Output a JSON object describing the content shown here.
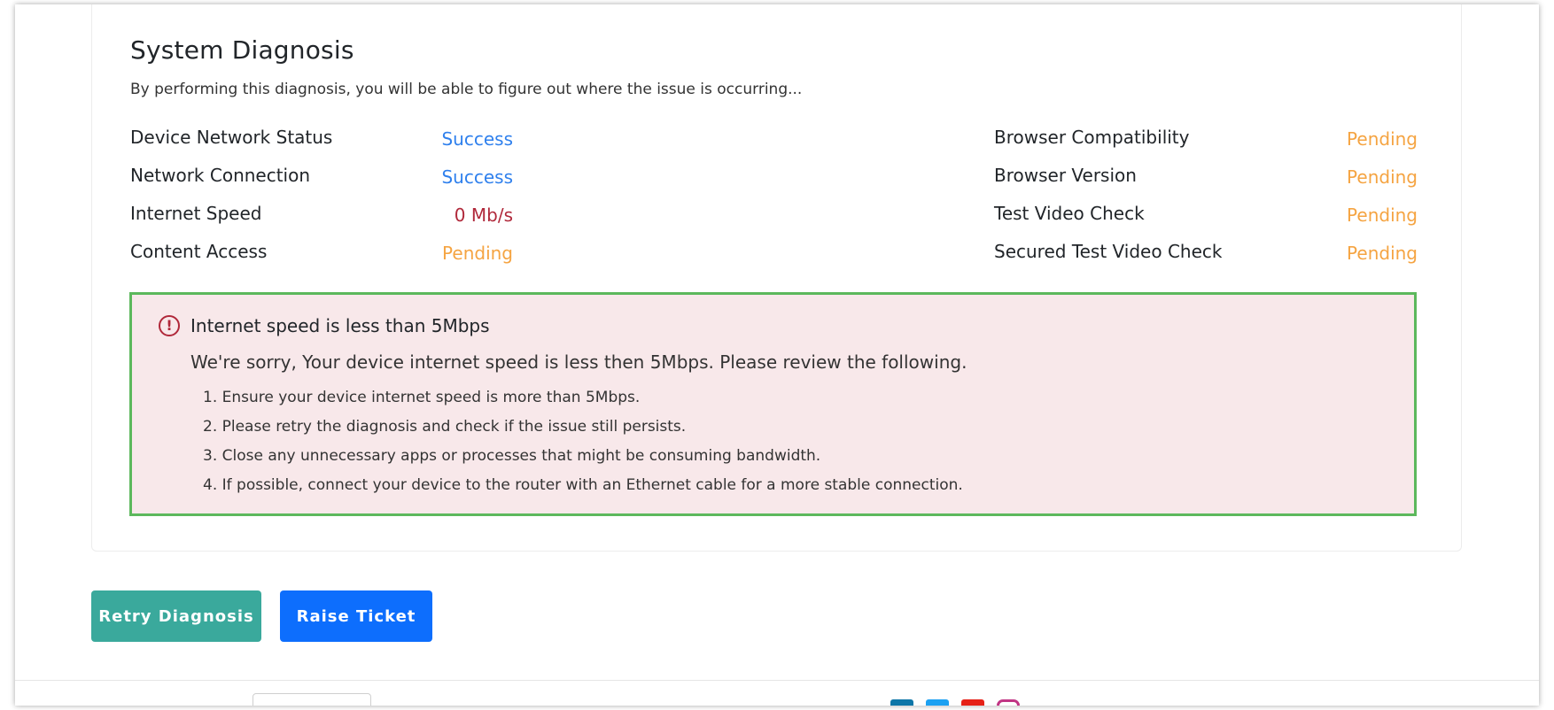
{
  "diagnosis": {
    "title": "System Diagnosis",
    "subtitle": "By performing this diagnosis, you will be able to figure out where the issue is occurring...",
    "left_checks": [
      {
        "label": "Device Network Status",
        "status": "Success",
        "state": "success"
      },
      {
        "label": "Network Connection",
        "status": "Success",
        "state": "success"
      },
      {
        "label": "Internet Speed",
        "status": "0 Mb/s",
        "state": "error"
      },
      {
        "label": "Content Access",
        "status": "Pending",
        "state": "pending"
      }
    ],
    "right_checks": [
      {
        "label": "Browser Compatibility",
        "status": "Pending",
        "state": "pending"
      },
      {
        "label": "Browser Version",
        "status": "Pending",
        "state": "pending"
      },
      {
        "label": "Test Video Check",
        "status": "Pending",
        "state": "pending"
      },
      {
        "label": "Secured Test Video Check",
        "status": "Pending",
        "state": "pending"
      }
    ]
  },
  "alert": {
    "icon": "exclamation-circle-icon",
    "heading": "Internet speed is less than 5Mbps",
    "message": "We're sorry, Your device internet speed is less then 5Mbps. Please review the following.",
    "steps": [
      "1. Ensure your device internet speed is more than 5Mbps.",
      "2. Please retry the diagnosis and check if the issue still persists.",
      "3. Close any unnecessary apps or processes that might be consuming bandwidth.",
      "4. If possible, connect your device to the router with an Ethernet cable for a more stable connection."
    ]
  },
  "actions": {
    "retry_label": "Retry Diagnosis",
    "ticket_label": "Raise Ticket"
  },
  "colors": {
    "success": "#2f80ed",
    "pending": "#f5a442",
    "error": "#b0283a",
    "alert_bg": "#f8e8ea",
    "alert_border": "#5cb85c",
    "retry_button": "#3aa99c",
    "ticket_button": "#0d6efd"
  },
  "footer": {
    "social_icons": [
      "linkedin-icon",
      "twitter-icon",
      "youtube-icon",
      "instagram-icon"
    ]
  }
}
